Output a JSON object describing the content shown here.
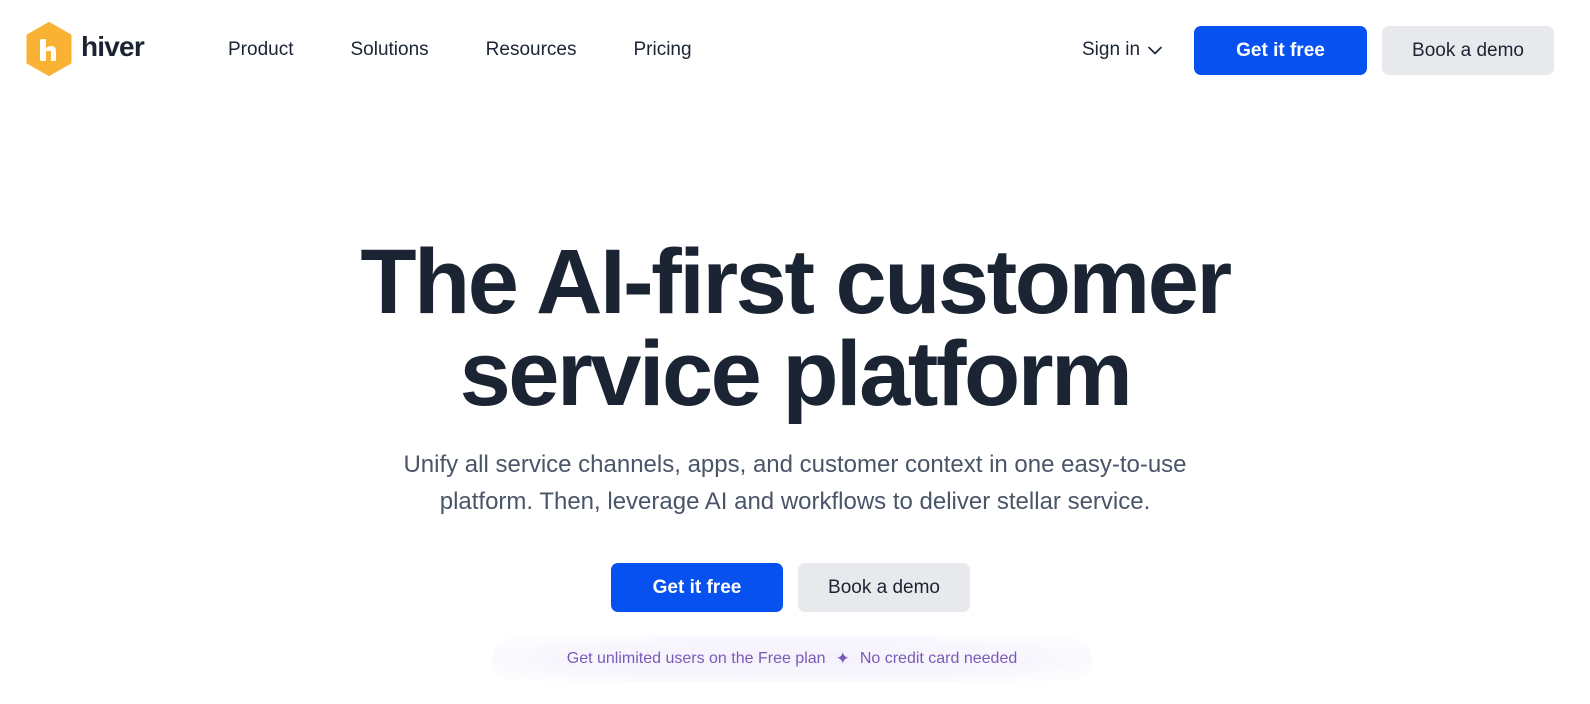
{
  "brand": {
    "name": "hiver",
    "logo_color": "#f9b234",
    "logo_icon": "hiver-hexagon-logo-icon"
  },
  "header": {
    "nav": [
      "Product",
      "Solutions",
      "Resources",
      "Pricing"
    ],
    "sign_in": "Sign in",
    "sign_in_icon": "chevron-down-icon",
    "get_free": "Get it free",
    "book_demo": "Book a demo"
  },
  "hero": {
    "title_line1": "The AI-first customer",
    "title_line2": "service platform",
    "subtitle_line1": "Unify all service channels, apps, and customer context in one easy-to-use",
    "subtitle_line2": "platform. Then, leverage AI and workflows to deliver stellar service.",
    "get_free": "Get it free",
    "book_demo": "Book a demo",
    "note_left": "Get unlimited users on the Free plan",
    "note_separator": "✦",
    "note_right": "No credit card needed"
  },
  "colors": {
    "primary": "#0651f0",
    "secondary": "#e8e9ec",
    "text": "#1b2433",
    "subtle_text": "#4a5568",
    "note_text": "#7a5ab8"
  }
}
